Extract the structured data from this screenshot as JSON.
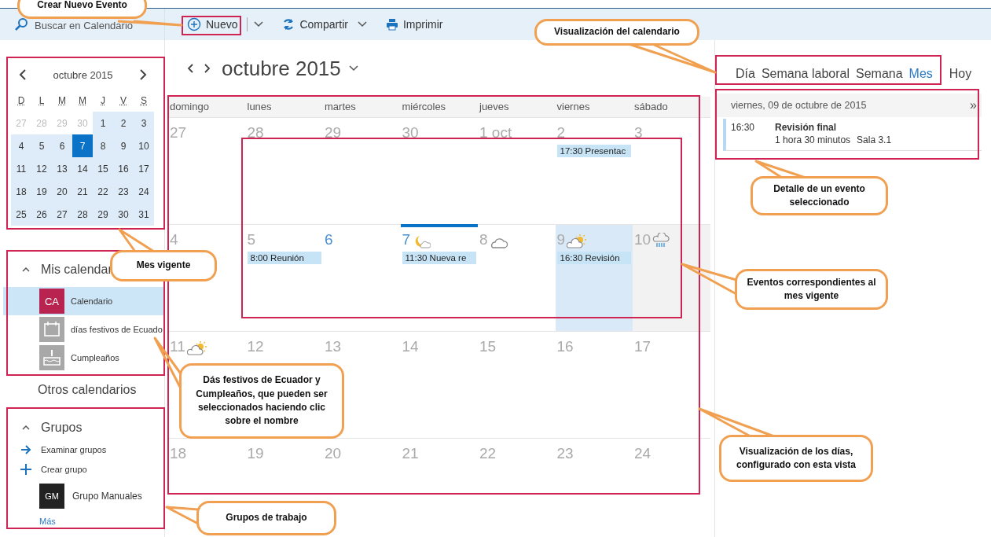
{
  "search": {
    "placeholder": "Buscar en Calendario"
  },
  "toolbar": [
    {
      "label": "Nuevo",
      "kind": "new",
      "menu": true
    },
    {
      "label": "Compartir",
      "kind": "share",
      "menu": true
    },
    {
      "label": "Imprimir",
      "kind": "print",
      "menu": false
    }
  ],
  "mini_calendar": {
    "title": "octubre 2015",
    "weekdays": [
      "D",
      "L",
      "M",
      "M",
      "J",
      "V",
      "S"
    ],
    "weeks": [
      [
        {
          "day": "27",
          "in_month": false,
          "selected": false
        },
        {
          "day": "28",
          "in_month": false,
          "selected": false
        },
        {
          "day": "29",
          "in_month": false,
          "selected": false
        },
        {
          "day": "30",
          "in_month": false,
          "selected": false
        },
        {
          "day": "1",
          "in_month": true,
          "selected": false
        },
        {
          "day": "2",
          "in_month": true,
          "selected": false
        },
        {
          "day": "3",
          "in_month": true,
          "selected": false
        }
      ],
      [
        {
          "day": "4",
          "in_month": true,
          "selected": false
        },
        {
          "day": "5",
          "in_month": true,
          "selected": false
        },
        {
          "day": "6",
          "in_month": true,
          "selected": false
        },
        {
          "day": "7",
          "in_month": true,
          "selected": true
        },
        {
          "day": "8",
          "in_month": true,
          "selected": false
        },
        {
          "day": "9",
          "in_month": true,
          "selected": false
        },
        {
          "day": "10",
          "in_month": true,
          "selected": false
        }
      ],
      [
        {
          "day": "11",
          "in_month": true,
          "selected": false
        },
        {
          "day": "12",
          "in_month": true,
          "selected": false
        },
        {
          "day": "13",
          "in_month": true,
          "selected": false
        },
        {
          "day": "14",
          "in_month": true,
          "selected": false
        },
        {
          "day": "15",
          "in_month": true,
          "selected": false
        },
        {
          "day": "16",
          "in_month": true,
          "selected": false
        },
        {
          "day": "17",
          "in_month": true,
          "selected": false
        }
      ],
      [
        {
          "day": "18",
          "in_month": true,
          "selected": false
        },
        {
          "day": "19",
          "in_month": true,
          "selected": false
        },
        {
          "day": "20",
          "in_month": true,
          "selected": false
        },
        {
          "day": "21",
          "in_month": true,
          "selected": false
        },
        {
          "day": "22",
          "in_month": true,
          "selected": false
        },
        {
          "day": "23",
          "in_month": true,
          "selected": false
        },
        {
          "day": "24",
          "in_month": true,
          "selected": false
        }
      ],
      [
        {
          "day": "25",
          "in_month": true,
          "selected": false
        },
        {
          "day": "26",
          "in_month": true,
          "selected": false
        },
        {
          "day": "27",
          "in_month": true,
          "selected": false
        },
        {
          "day": "28",
          "in_month": true,
          "selected": false
        },
        {
          "day": "29",
          "in_month": true,
          "selected": false
        },
        {
          "day": "30",
          "in_month": true,
          "selected": false
        },
        {
          "day": "31",
          "in_month": true,
          "selected": false
        }
      ]
    ]
  },
  "my_calendars": {
    "title": "Mis calendar",
    "expanded": true,
    "items": [
      {
        "label": "Calendario",
        "kind": "initials",
        "badge": "CA",
        "selected": true
      },
      {
        "label": "días festivos de Ecuado",
        "kind": "calendar",
        "selected": false
      },
      {
        "label": "Cumpleaños",
        "kind": "cake",
        "selected": false
      }
    ]
  },
  "other_calendars": {
    "title": "Otros calendarios"
  },
  "groups": {
    "title": "Grupos",
    "expanded": true,
    "actions": [
      {
        "label": "Examinar grupos",
        "kind": "browse"
      },
      {
        "label": "Crear grupo",
        "kind": "create"
      }
    ],
    "items": [
      {
        "badge": "GM",
        "label": "Grupo Manuales"
      }
    ],
    "more": "Más"
  },
  "month_header": {
    "title": "octubre 2015"
  },
  "views": [
    {
      "label": "Día",
      "selected": false
    },
    {
      "label": "Semana laboral",
      "selected": false
    },
    {
      "label": "Semana",
      "selected": false
    },
    {
      "label": "Mes",
      "selected": true
    }
  ],
  "today_button": "Hoy",
  "month_grid": {
    "weekdays": [
      "domingo",
      "lunes",
      "martes",
      "miércoles",
      "jueves",
      "viernes",
      "sábado"
    ],
    "weeks": [
      [
        {
          "day": "27",
          "accent": false,
          "today": false,
          "selected": false,
          "shaded": false
        },
        {
          "day": "28",
          "accent": false,
          "today": false,
          "selected": false,
          "shaded": false
        },
        {
          "day": "29",
          "accent": false,
          "today": false,
          "selected": false,
          "shaded": false
        },
        {
          "day": "30",
          "accent": false,
          "today": false,
          "selected": false,
          "shaded": false
        },
        {
          "day": "1 oct",
          "accent": false,
          "today": false,
          "selected": false,
          "shaded": false
        },
        {
          "day": "2",
          "accent": false,
          "today": false,
          "selected": false,
          "shaded": false,
          "events": [
            "17:30 Presentac"
          ]
        },
        {
          "day": "3",
          "accent": false,
          "today": false,
          "selected": false,
          "shaded": false
        }
      ],
      [
        {
          "day": "4",
          "accent": false,
          "today": false,
          "selected": false,
          "shaded": false
        },
        {
          "day": "5",
          "accent": false,
          "today": false,
          "selected": false,
          "shaded": false,
          "events": [
            "8:00 Reunión"
          ]
        },
        {
          "day": "6",
          "accent": true,
          "today": false,
          "selected": false,
          "shaded": false
        },
        {
          "day": "7",
          "accent": true,
          "today": true,
          "selected": false,
          "shaded": false,
          "weather": {
            "kind": "moon"
          },
          "events": [
            "11:30 Nueva re"
          ]
        },
        {
          "day": "8",
          "accent": false,
          "today": false,
          "selected": false,
          "shaded": false,
          "weather": {
            "kind": "cloud"
          }
        },
        {
          "day": "9",
          "accent": false,
          "today": false,
          "selected": true,
          "shaded": false,
          "weather": {
            "kind": "sun"
          },
          "events": [
            "16:30 Revisión"
          ]
        },
        {
          "day": "10",
          "accent": false,
          "today": false,
          "selected": false,
          "shaded": true,
          "weather": {
            "kind": "rain"
          }
        }
      ],
      [
        {
          "day": "11",
          "accent": false,
          "today": false,
          "selected": false,
          "shaded": false,
          "weather": {
            "kind": "sun"
          }
        },
        {
          "day": "12",
          "accent": false,
          "today": false,
          "selected": false,
          "shaded": false
        },
        {
          "day": "13",
          "accent": false,
          "today": false,
          "selected": false,
          "shaded": false
        },
        {
          "day": "14",
          "accent": false,
          "today": false,
          "selected": false,
          "shaded": false
        },
        {
          "day": "15",
          "accent": false,
          "today": false,
          "selected": false,
          "shaded": false
        },
        {
          "day": "16",
          "accent": false,
          "today": false,
          "selected": false,
          "shaded": false
        },
        {
          "day": "17",
          "accent": false,
          "today": false,
          "selected": false,
          "shaded": false
        }
      ],
      [
        {
          "day": "18",
          "accent": false,
          "today": false,
          "selected": false,
          "shaded": false
        },
        {
          "day": "19",
          "accent": false,
          "today": false,
          "selected": false,
          "shaded": false
        },
        {
          "day": "20",
          "accent": false,
          "today": false,
          "selected": false,
          "shaded": false
        },
        {
          "day": "21",
          "accent": false,
          "today": false,
          "selected": false,
          "shaded": false
        },
        {
          "day": "22",
          "accent": false,
          "today": false,
          "selected": false,
          "shaded": false
        },
        {
          "day": "23",
          "accent": false,
          "today": false,
          "selected": false,
          "shaded": false
        },
        {
          "day": "24",
          "accent": false,
          "today": false,
          "selected": false,
          "shaded": false
        }
      ]
    ]
  },
  "event_detail": {
    "date": "viernes, 09 de octubre de 2015",
    "expand": "»",
    "events": [
      {
        "time": "16:30",
        "title": "Revisión final",
        "duration": "1 hora 30 minutos",
        "location": "Sala 3.1"
      }
    ]
  },
  "annotations": [
    {
      "text": "Crear Nuevo Evento"
    },
    {
      "text": "Visualización del calendario"
    },
    {
      "text": "Mes vigente"
    },
    {
      "text": "Detalle de un evento seleccionado"
    },
    {
      "text": "Eventos correspondientes al mes vigente"
    },
    {
      "text": "Dás festivos de Ecuador y Cumpleaños, que pueden ser seleccionados haciendo clic sobre el nombre"
    },
    {
      "text": "Visualización de los días, configurado con esta vista"
    },
    {
      "text": "Grupos de trabajo"
    }
  ]
}
